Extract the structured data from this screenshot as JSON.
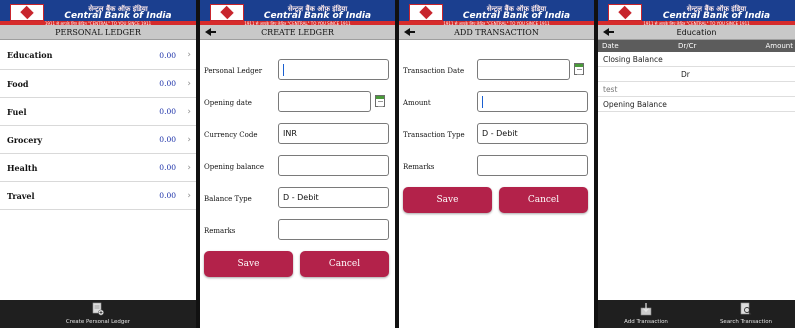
{
  "brand": {
    "hindi": "सेन्ट्रल बैंक ऑफ़ इंडिया",
    "english": "Central Bank of India",
    "tagline": "1911 से आपके लिए केंद्रित   \"CENTRAL\" TO YOU SINCE 1911"
  },
  "screens": {
    "personal_ledger": {
      "title": "PERSONAL LEDGER",
      "items": [
        {
          "name": "Education",
          "amount": "0.00"
        },
        {
          "name": "Food",
          "amount": "0.00"
        },
        {
          "name": "Fuel",
          "amount": "0.00"
        },
        {
          "name": "Grocery",
          "amount": "0.00"
        },
        {
          "name": "Health",
          "amount": "0.00"
        },
        {
          "name": "Travel",
          "amount": "0.00"
        }
      ],
      "footer_button": "Create Personal Ledger"
    },
    "create_ledger": {
      "title": "CREATE LEDGER",
      "fields": {
        "personal_ledger": {
          "label": "Personal Ledger",
          "value": ""
        },
        "opening_date": {
          "label": "Opening date",
          "value": ""
        },
        "currency_code": {
          "label": "Currency Code",
          "value": "INR"
        },
        "opening_balance": {
          "label": "Opening balance",
          "value": ""
        },
        "balance_type": {
          "label": "Balance Type",
          "value": "D - Debit"
        },
        "remarks": {
          "label": "Remarks",
          "value": ""
        }
      },
      "save_label": "Save",
      "cancel_label": "Cancel"
    },
    "add_transaction": {
      "title": "ADD TRANSACTION",
      "fields": {
        "transaction_date": {
          "label": "Transaction Date",
          "value": ""
        },
        "amount": {
          "label": "Amount",
          "value": ""
        },
        "transaction_type": {
          "label": "Transaction Type",
          "value": "D - Debit"
        },
        "remarks": {
          "label": "Remarks",
          "value": ""
        }
      },
      "save_label": "Save",
      "cancel_label": "Cancel"
    },
    "ledger_detail": {
      "title": "Education",
      "columns": {
        "date": "Date",
        "drcr": "Dr/Cr",
        "amount": "Amount"
      },
      "rows": {
        "closing": "Closing Balance",
        "dr": "Dr",
        "test": "test",
        "opening": "Opening Balance"
      },
      "footer": {
        "add": "Add Transaction",
        "search": "Search Transaction"
      }
    }
  },
  "colors": {
    "brand_blue": "#1b3f8f",
    "button": "#b3224a",
    "amount": "#1a2fa8"
  }
}
